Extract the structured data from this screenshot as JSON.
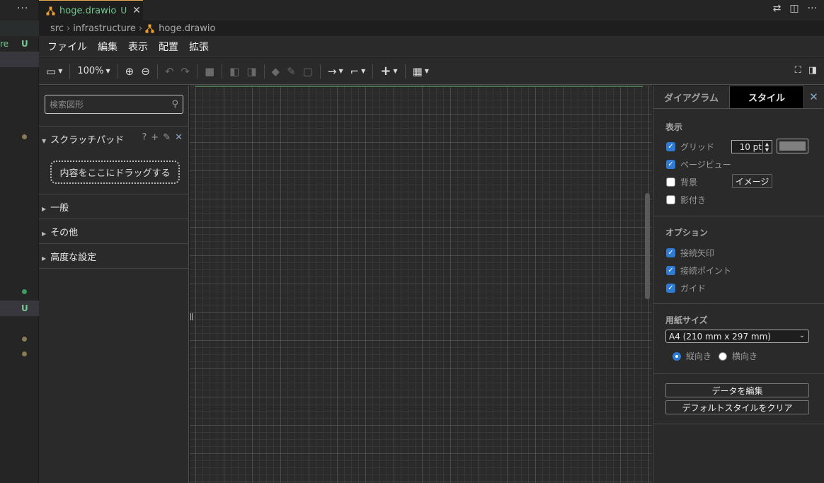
{
  "left_strip": {
    "more": "···",
    "fragment": "re",
    "status_u": "U",
    "status_u2": "U"
  },
  "tab": {
    "name": "hoge.drawio",
    "status": "U",
    "close": "✕"
  },
  "breadcrumb": {
    "parts": [
      "src",
      "infrastructure",
      "hoge.drawio"
    ],
    "sep": "›"
  },
  "menu": {
    "items": [
      "ファイル",
      "編集",
      "表示",
      "配置",
      "拡張"
    ]
  },
  "toolbar": {
    "zoom": "100%"
  },
  "shapes": {
    "search_placeholder": "検索図形",
    "scratchpad_title": "スクラッチパッド",
    "scratchpad_help": "?",
    "drop_hint": "内容をここにドラッグする",
    "groups": [
      "一般",
      "その他",
      "高度な設定"
    ]
  },
  "format": {
    "tabs": [
      "ダイアグラム",
      "スタイル"
    ],
    "close": "✕",
    "view_section": "表示",
    "view_options": [
      {
        "label": "グリッド",
        "checked": true
      },
      {
        "label": "ページビュー",
        "checked": true
      },
      {
        "label": "背景",
        "checked": false
      },
      {
        "label": "影付き",
        "checked": false
      }
    ],
    "grid_size": "10 pt",
    "grid_color": "#808080",
    "image_button": "イメージ",
    "options_section": "オプション",
    "options": [
      {
        "label": "接続矢印",
        "checked": true
      },
      {
        "label": "接続ポイント",
        "checked": true
      },
      {
        "label": "ガイド",
        "checked": true
      }
    ],
    "paper_section": "用紙サイズ",
    "paper_size": "A4 (210 mm x 297 mm)",
    "orientation": [
      {
        "label": "縦向き",
        "selected": true
      },
      {
        "label": "横向き",
        "selected": false
      }
    ],
    "edit_data_button": "データを編集",
    "clear_style_button": "デフォルトスタイルをクリア"
  },
  "colors": {
    "accent": "#2f7bd4",
    "git_untracked": "#73c991",
    "drawio_orange": "#f0a030"
  }
}
